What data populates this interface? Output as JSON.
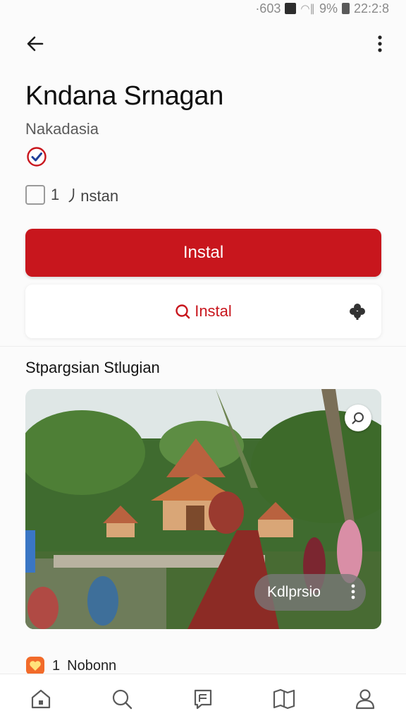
{
  "status_bar": {
    "left_text": "·603",
    "signal_text": "9%",
    "time": "22:2:8"
  },
  "app": {
    "title": "Kndana Srnagan",
    "subtitle": "Nakadasia",
    "install_count": "1",
    "install_label": "⼃nstan"
  },
  "actions": {
    "install_label": "Instal",
    "secondary_install_label": "Instal"
  },
  "section": {
    "title": "Stpargsian Stlugian"
  },
  "media": {
    "chip_label": "Kdlprsio"
  },
  "activity": {
    "count": "1",
    "label": "Nobonn"
  },
  "colors": {
    "accent": "#c8161d",
    "background": "#fbfbfb"
  },
  "nav": [
    {
      "icon": "home-icon"
    },
    {
      "icon": "search-icon"
    },
    {
      "icon": "review-icon"
    },
    {
      "icon": "map-book-icon"
    },
    {
      "icon": "profile-icon"
    }
  ]
}
